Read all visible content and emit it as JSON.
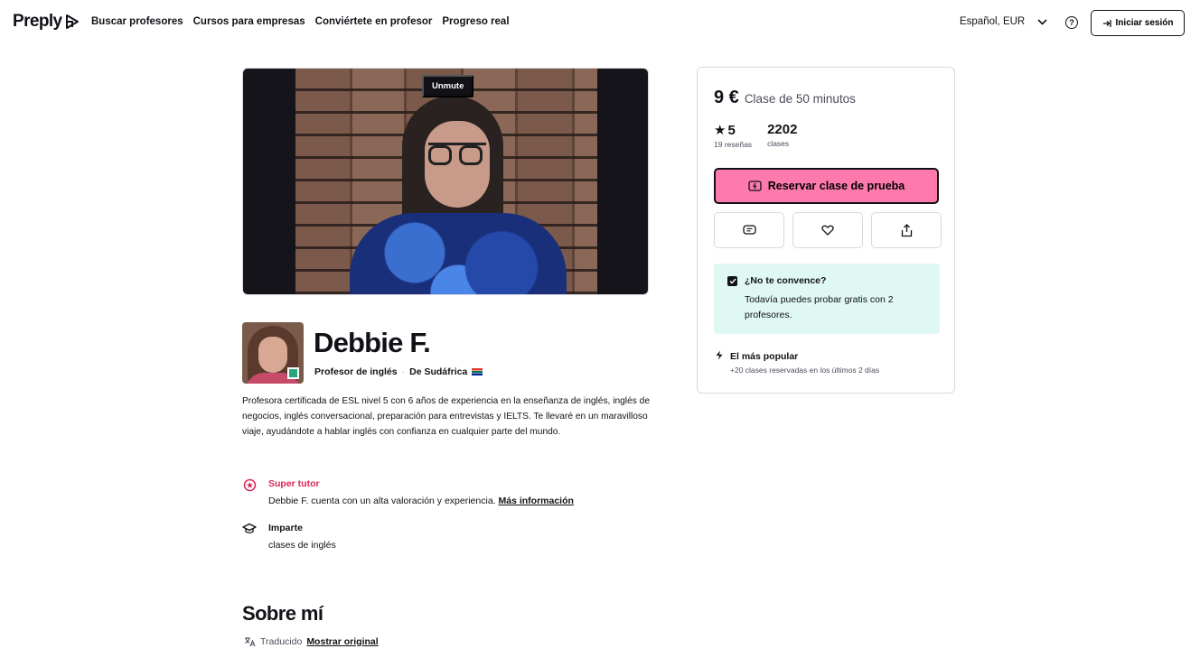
{
  "header": {
    "logo": "Preply",
    "nav": [
      "Buscar profesores",
      "Cursos para empresas",
      "Conviértete en profesor",
      "Progreso real"
    ],
    "language": "Español, EUR",
    "help_icon": "question-circle-icon",
    "login": "Iniciar sesión"
  },
  "video": {
    "unmute": "Unmute"
  },
  "profile": {
    "name": "Debbie F.",
    "subject": "Profesor de inglés",
    "origin": "De Sudáfrica",
    "bio": "Profesora certificada de ESL nivel 5 con 6 años de experiencia en la enseñanza de inglés, inglés de negocios, inglés conversacional, preparación para entrevistas y IELTS. Te llevaré en un maravilloso viaje, ayudándote a hablar inglés con confianza en cualquier parte del mundo.",
    "super_tutor": {
      "title": "Super tutor",
      "desc": "Debbie F. cuenta con un alta valoración y experiencia.",
      "link": "Más información"
    },
    "teaches": {
      "title": "Imparte",
      "desc": "clases de inglés"
    }
  },
  "about": {
    "title": "Sobre mí",
    "translated": "Traducido",
    "show_original": "Mostrar original"
  },
  "booking": {
    "price": "9 €",
    "lesson": "Clase de 50 minutos",
    "rating": "5",
    "reviews": "19 reseñas",
    "lessons_count": "2202",
    "lessons_label": "clases",
    "book_button": "Reservar clase de prueba",
    "promo_title": "¿No te convence?",
    "promo_desc": "Todavía puedes probar gratis con 2 profesores.",
    "popular_title": "El más popular",
    "popular_desc": "+20 clases reservadas en los últimos 2 días"
  },
  "colors": {
    "accent": "#ff7aac",
    "promo_bg": "#dff8f3",
    "super_tutor": "#d6265a"
  }
}
